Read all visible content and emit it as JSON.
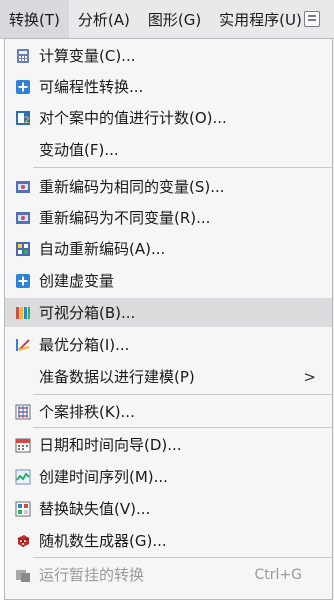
{
  "menubar": {
    "items": [
      {
        "label": "转换(T)"
      },
      {
        "label": "分析(A)"
      },
      {
        "label": "图形(G)"
      },
      {
        "label": "实用程序(U)"
      }
    ]
  },
  "menu": {
    "items": [
      {
        "label": "计算变量(C)...",
        "icon": "calculator-icon"
      },
      {
        "label": "可编程性转换...",
        "icon": "plus-icon"
      },
      {
        "label": "对个案中的值进行计数(O)...",
        "icon": "count-icon"
      },
      {
        "label": "变动值(F)...",
        "icon": ""
      },
      {
        "label": "重新编码为相同的变量(S)...",
        "icon": "recode-same-icon"
      },
      {
        "label": "重新编码为不同变量(R)...",
        "icon": "recode-different-icon"
      },
      {
        "label": "自动重新编码(A)...",
        "icon": "auto-recode-icon"
      },
      {
        "label": "创建虚变量",
        "icon": "plus-icon"
      },
      {
        "label": "可视分箱(B)...",
        "icon": "visual-binning-icon"
      },
      {
        "label": "最优分箱(I)...",
        "icon": "optimal-binning-icon"
      },
      {
        "label": "准备数据以进行建模(P)",
        "icon": "",
        "submenu_arrow": ">"
      },
      {
        "label": "个案排秩(K)...",
        "icon": "rank-cases-icon"
      },
      {
        "label": "日期和时间向导(D)...",
        "icon": "calendar-icon"
      },
      {
        "label": "创建时间序列(M)...",
        "icon": "time-series-icon"
      },
      {
        "label": "替换缺失值(V)...",
        "icon": "missing-values-icon"
      },
      {
        "label": "随机数生成器(G)...",
        "icon": "dice-icon"
      },
      {
        "label": "运行暂挂的转换",
        "icon": "pending-transform-icon",
        "shortcut": "Ctrl+G",
        "disabled": true
      }
    ]
  }
}
